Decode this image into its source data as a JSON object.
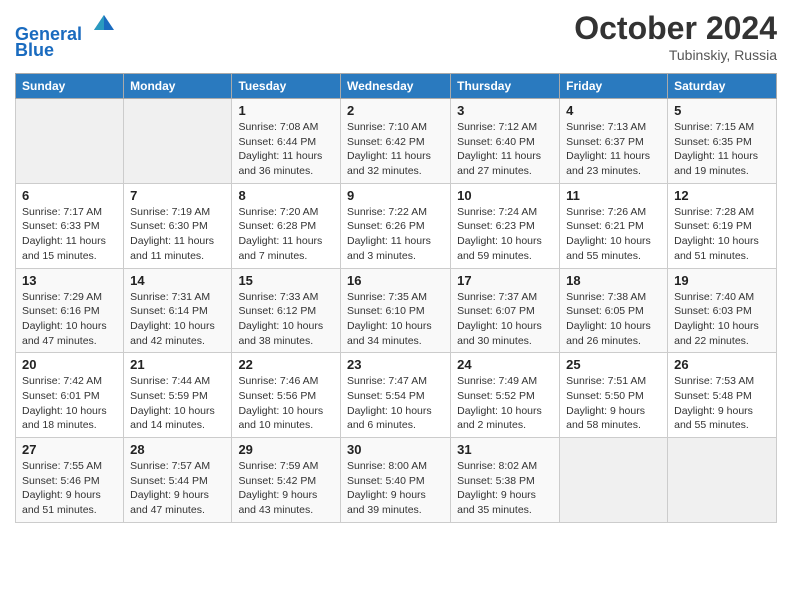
{
  "header": {
    "logo_line1": "General",
    "logo_line2": "Blue",
    "month": "October 2024",
    "location": "Tubinskiy, Russia"
  },
  "days_of_week": [
    "Sunday",
    "Monday",
    "Tuesday",
    "Wednesday",
    "Thursday",
    "Friday",
    "Saturday"
  ],
  "weeks": [
    [
      {
        "day": "",
        "detail": ""
      },
      {
        "day": "",
        "detail": ""
      },
      {
        "day": "1",
        "detail": "Sunrise: 7:08 AM\nSunset: 6:44 PM\nDaylight: 11 hours and 36 minutes."
      },
      {
        "day": "2",
        "detail": "Sunrise: 7:10 AM\nSunset: 6:42 PM\nDaylight: 11 hours and 32 minutes."
      },
      {
        "day": "3",
        "detail": "Sunrise: 7:12 AM\nSunset: 6:40 PM\nDaylight: 11 hours and 27 minutes."
      },
      {
        "day": "4",
        "detail": "Sunrise: 7:13 AM\nSunset: 6:37 PM\nDaylight: 11 hours and 23 minutes."
      },
      {
        "day": "5",
        "detail": "Sunrise: 7:15 AM\nSunset: 6:35 PM\nDaylight: 11 hours and 19 minutes."
      }
    ],
    [
      {
        "day": "6",
        "detail": "Sunrise: 7:17 AM\nSunset: 6:33 PM\nDaylight: 11 hours and 15 minutes."
      },
      {
        "day": "7",
        "detail": "Sunrise: 7:19 AM\nSunset: 6:30 PM\nDaylight: 11 hours and 11 minutes."
      },
      {
        "day": "8",
        "detail": "Sunrise: 7:20 AM\nSunset: 6:28 PM\nDaylight: 11 hours and 7 minutes."
      },
      {
        "day": "9",
        "detail": "Sunrise: 7:22 AM\nSunset: 6:26 PM\nDaylight: 11 hours and 3 minutes."
      },
      {
        "day": "10",
        "detail": "Sunrise: 7:24 AM\nSunset: 6:23 PM\nDaylight: 10 hours and 59 minutes."
      },
      {
        "day": "11",
        "detail": "Sunrise: 7:26 AM\nSunset: 6:21 PM\nDaylight: 10 hours and 55 minutes."
      },
      {
        "day": "12",
        "detail": "Sunrise: 7:28 AM\nSunset: 6:19 PM\nDaylight: 10 hours and 51 minutes."
      }
    ],
    [
      {
        "day": "13",
        "detail": "Sunrise: 7:29 AM\nSunset: 6:16 PM\nDaylight: 10 hours and 47 minutes."
      },
      {
        "day": "14",
        "detail": "Sunrise: 7:31 AM\nSunset: 6:14 PM\nDaylight: 10 hours and 42 minutes."
      },
      {
        "day": "15",
        "detail": "Sunrise: 7:33 AM\nSunset: 6:12 PM\nDaylight: 10 hours and 38 minutes."
      },
      {
        "day": "16",
        "detail": "Sunrise: 7:35 AM\nSunset: 6:10 PM\nDaylight: 10 hours and 34 minutes."
      },
      {
        "day": "17",
        "detail": "Sunrise: 7:37 AM\nSunset: 6:07 PM\nDaylight: 10 hours and 30 minutes."
      },
      {
        "day": "18",
        "detail": "Sunrise: 7:38 AM\nSunset: 6:05 PM\nDaylight: 10 hours and 26 minutes."
      },
      {
        "day": "19",
        "detail": "Sunrise: 7:40 AM\nSunset: 6:03 PM\nDaylight: 10 hours and 22 minutes."
      }
    ],
    [
      {
        "day": "20",
        "detail": "Sunrise: 7:42 AM\nSunset: 6:01 PM\nDaylight: 10 hours and 18 minutes."
      },
      {
        "day": "21",
        "detail": "Sunrise: 7:44 AM\nSunset: 5:59 PM\nDaylight: 10 hours and 14 minutes."
      },
      {
        "day": "22",
        "detail": "Sunrise: 7:46 AM\nSunset: 5:56 PM\nDaylight: 10 hours and 10 minutes."
      },
      {
        "day": "23",
        "detail": "Sunrise: 7:47 AM\nSunset: 5:54 PM\nDaylight: 10 hours and 6 minutes."
      },
      {
        "day": "24",
        "detail": "Sunrise: 7:49 AM\nSunset: 5:52 PM\nDaylight: 10 hours and 2 minutes."
      },
      {
        "day": "25",
        "detail": "Sunrise: 7:51 AM\nSunset: 5:50 PM\nDaylight: 9 hours and 58 minutes."
      },
      {
        "day": "26",
        "detail": "Sunrise: 7:53 AM\nSunset: 5:48 PM\nDaylight: 9 hours and 55 minutes."
      }
    ],
    [
      {
        "day": "27",
        "detail": "Sunrise: 7:55 AM\nSunset: 5:46 PM\nDaylight: 9 hours and 51 minutes."
      },
      {
        "day": "28",
        "detail": "Sunrise: 7:57 AM\nSunset: 5:44 PM\nDaylight: 9 hours and 47 minutes."
      },
      {
        "day": "29",
        "detail": "Sunrise: 7:59 AM\nSunset: 5:42 PM\nDaylight: 9 hours and 43 minutes."
      },
      {
        "day": "30",
        "detail": "Sunrise: 8:00 AM\nSunset: 5:40 PM\nDaylight: 9 hours and 39 minutes."
      },
      {
        "day": "31",
        "detail": "Sunrise: 8:02 AM\nSunset: 5:38 PM\nDaylight: 9 hours and 35 minutes."
      },
      {
        "day": "",
        "detail": ""
      },
      {
        "day": "",
        "detail": ""
      }
    ]
  ]
}
